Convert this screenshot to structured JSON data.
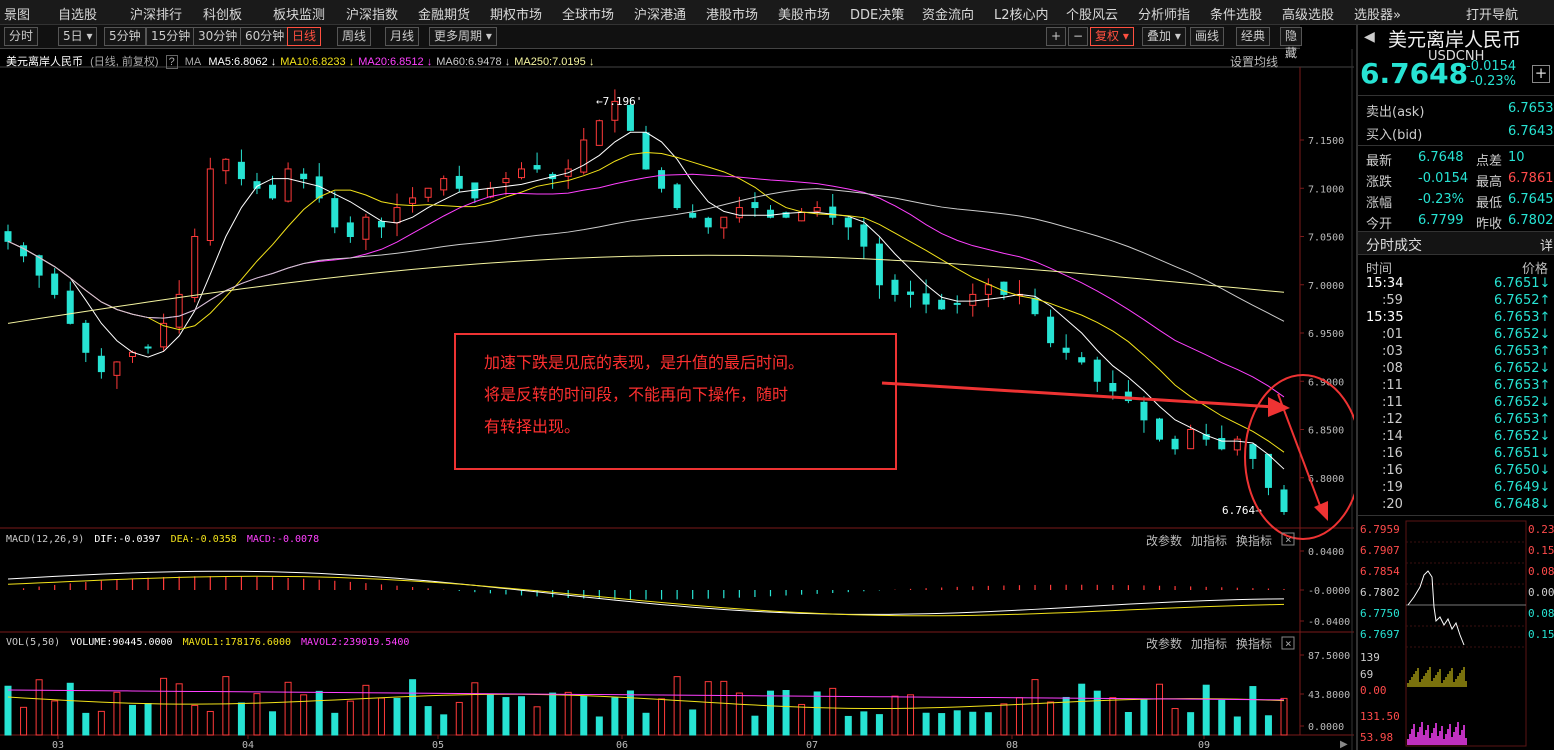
{
  "menu": [
    "景图",
    "自选股",
    "沪深排行",
    "科创板",
    "板块监测",
    "沪深指数",
    "金融期货",
    "期权市场",
    "全球市场",
    "沪深港通",
    "港股市场",
    "美股市场",
    "DDE决策",
    "资金流向",
    "L2核心内",
    "个股风云",
    "分析师指",
    "条件选股",
    "高级选股",
    "选股器»",
    "打开导航"
  ],
  "periods": [
    "分时",
    "5日",
    "5分钟",
    "15分钟",
    "30分钟",
    "60分钟",
    "日线",
    "周线",
    "月线",
    "更多周期"
  ],
  "active_period": "日线",
  "right_tools": [
    "+",
    "−",
    "复权",
    "叠加",
    "画线",
    "经典",
    "隐藏"
  ],
  "chart_name": "美元离岸人民币",
  "chart_sub": "(日线, 前复权)",
  "ma_legend": [
    {
      "label": "MA5:6.8062",
      "color": "#ffffff"
    },
    {
      "label": "MA10:6.8233",
      "color": "#f2e21a"
    },
    {
      "label": "MA20:6.8512",
      "color": "#ff40ff"
    },
    {
      "label": "MA60:6.9478",
      "color": "#cccccc"
    },
    {
      "label": "MA250:7.0195",
      "color": "#f5f5a0"
    }
  ],
  "ma_prefix": "MA",
  "settings_label": "设置均线",
  "macd_legend": {
    "name": "MACD(12,26,9)",
    "dif": "DIF:-0.0397",
    "dea": "DEA:-0.0358",
    "macd": "MACD:-0.0078"
  },
  "vol_legend": {
    "name": "VOL(5,50)",
    "volume": "VOLUME:90445.0000",
    "mavol1": "MAVOL1:178176.6000",
    "mavol2": "MAVOL2:239019.5400"
  },
  "indicator_buttons": [
    "改参数",
    "加指标",
    "换指标"
  ],
  "high_label": "7.196",
  "low_label": "6.764",
  "annotation": [
    "加速下跌是见底的表现，是升值的最后时间。",
    "将是反转的时间段，不能再向下操作，随时",
    "有转择出现。"
  ],
  "colors": {
    "up": "#ff3a3a",
    "down": "#27e3d3",
    "annotation": "#ff3030"
  },
  "chart_data": {
    "type": "candlestick",
    "price_axis": {
      "min": 6.75,
      "max": 7.2,
      "ticks": [
        "7.1500",
        "7.1000",
        "7.0500",
        "7.0000",
        "6.9500",
        "6.9000",
        "6.8500",
        "6.8000"
      ]
    },
    "macd_axis": {
      "ticks": [
        "0.0400",
        "-0.0000",
        "-0.0400"
      ]
    },
    "vol_axis": {
      "ticks": [
        "87.5000",
        "43.8000",
        "0.0000"
      ]
    },
    "x_ticks": [
      "03",
      "04",
      "05",
      "06",
      "07",
      "08",
      "09"
    ],
    "close_series": [
      7.045,
      7.03,
      7.01,
      6.99,
      6.96,
      6.93,
      6.91,
      6.92,
      6.93,
      6.935,
      6.96,
      6.99,
      7.05,
      7.12,
      7.13,
      7.11,
      7.1,
      7.09,
      7.12,
      7.11,
      7.09,
      7.06,
      7.05,
      7.07,
      7.06,
      7.08,
      7.09,
      7.1,
      7.11,
      7.1,
      7.09,
      7.1,
      7.11,
      7.12,
      7.12,
      7.11,
      7.12,
      7.15,
      7.17,
      7.19,
      7.16,
      7.12,
      7.1,
      7.08,
      7.07,
      7.06,
      7.07,
      7.08,
      7.08,
      7.07,
      7.07,
      7.075,
      7.08,
      7.07,
      7.06,
      7.04,
      7.0,
      6.99,
      6.99,
      6.98,
      6.975,
      6.98,
      6.99,
      7.0,
      6.99,
      6.99,
      6.97,
      6.94,
      6.93,
      6.92,
      6.9,
      6.89,
      6.88,
      6.86,
      6.84,
      6.83,
      6.85,
      6.84,
      6.83,
      6.84,
      6.82,
      6.79,
      6.765
    ]
  },
  "side": {
    "name": "美元离岸人民币",
    "code": "USDCNH",
    "price": "6.7648",
    "change": "-0.0154",
    "pct": "-0.23%",
    "ask_label": "卖出(ask)",
    "ask": "6.7653",
    "bid_label": "买入(bid)",
    "bid": "6.7643",
    "stats": [
      {
        "l": "最新",
        "v": "6.7648",
        "l2": "点差",
        "v2": "10"
      },
      {
        "l": "涨跌",
        "v": "-0.0154",
        "l2": "最高",
        "v2": "6.7861"
      },
      {
        "l": "涨幅",
        "v": "-0.23%",
        "l2": "最低",
        "v2": "6.7645"
      },
      {
        "l": "今开",
        "v": "6.7799",
        "l2": "昨收",
        "v2": "6.7802"
      }
    ],
    "ticks_title": "分时成交",
    "ticks_btn": "详",
    "ticks_head_time": "时间",
    "ticks_head_price": "价格",
    "ticks": [
      {
        "t": "15:34",
        "p": "6.7651↓"
      },
      {
        "t": ":59",
        "p": "6.7652↑"
      },
      {
        "t": "15:35",
        "p": "6.7653↑"
      },
      {
        "t": ":01",
        "p": "6.7652↓"
      },
      {
        "t": ":03",
        "p": "6.7653↑"
      },
      {
        "t": ":08",
        "p": "6.7652↓"
      },
      {
        "t": ":11",
        "p": "6.7653↑"
      },
      {
        "t": ":11",
        "p": "6.7652↓"
      },
      {
        "t": ":12",
        "p": "6.7653↑"
      },
      {
        "t": ":14",
        "p": "6.7652↓"
      },
      {
        "t": ":16",
        "p": "6.7651↓"
      },
      {
        "t": ":16",
        "p": "6.7650↓"
      },
      {
        "t": ":19",
        "p": "6.7649↓"
      },
      {
        "t": ":20",
        "p": "6.7648↓"
      }
    ],
    "mini_left": [
      "6.7959",
      "6.7907",
      "6.7854",
      "6.7802",
      "6.7750",
      "6.7697",
      "139",
      "69",
      "0.00",
      "131.50",
      "53.98"
    ],
    "mini_right": [
      "0.23",
      "0.15",
      "0.08",
      "0.00",
      "0.08",
      "0.15"
    ]
  }
}
